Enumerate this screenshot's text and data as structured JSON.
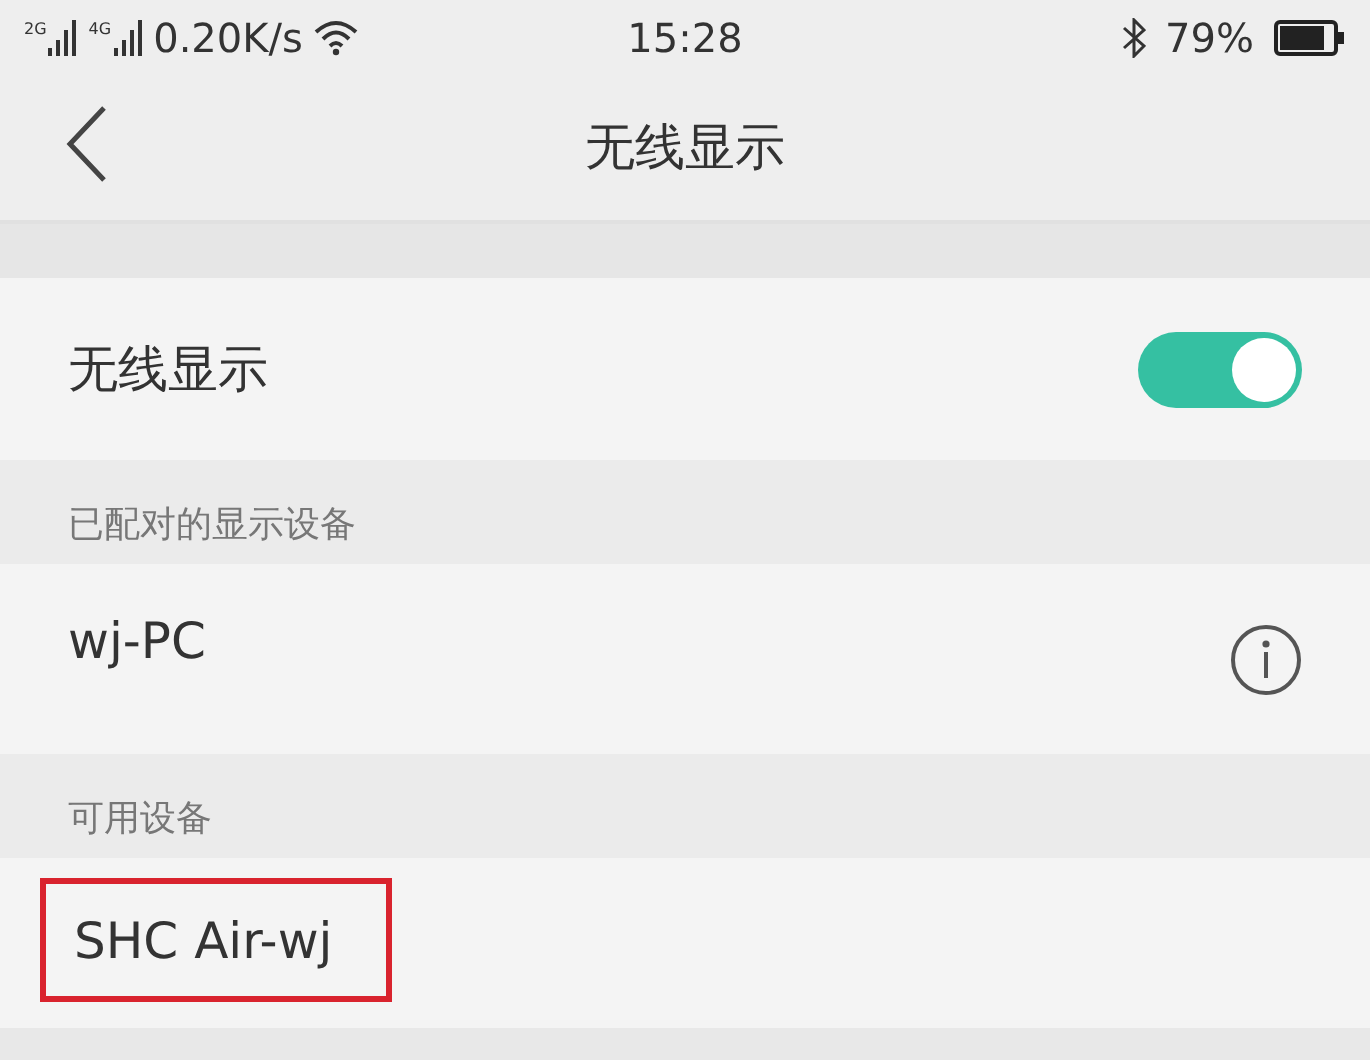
{
  "status_bar": {
    "sim_labels": [
      "2G",
      "4G"
    ],
    "speed": "0.20K/s",
    "time": "15:28",
    "battery": "79%"
  },
  "header": {
    "title": "无线显示"
  },
  "toggle": {
    "label": "无线显示",
    "on": true
  },
  "sections": [
    {
      "title": "已配对的显示设备",
      "devices": [
        {
          "name": "wj-PC",
          "info": true,
          "highlighted": false
        }
      ]
    },
    {
      "title": "可用设备",
      "devices": [
        {
          "name": "SHC Air-wj",
          "info": false,
          "highlighted": true
        }
      ]
    }
  ]
}
